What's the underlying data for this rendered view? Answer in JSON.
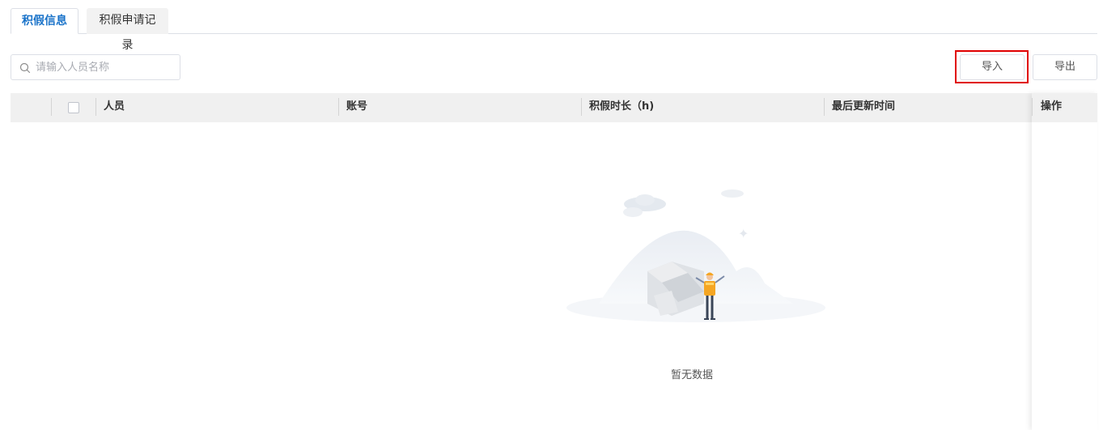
{
  "tabs": [
    {
      "label": "积假信息",
      "active": true
    },
    {
      "label": "积假申请记录",
      "active": false
    }
  ],
  "search": {
    "placeholder": "请输入人员名称",
    "value": ""
  },
  "toolbar": {
    "import_label": "导入",
    "export_label": "导出"
  },
  "table": {
    "columns": [
      "人员",
      "账号",
      "积假时长（h)",
      "最后更新时间",
      "操作"
    ],
    "rows": []
  },
  "empty": {
    "text": "暂无数据"
  },
  "colors": {
    "accent": "#1a73c9",
    "highlight": "#e00000",
    "header_bg": "#f0f0f0"
  }
}
